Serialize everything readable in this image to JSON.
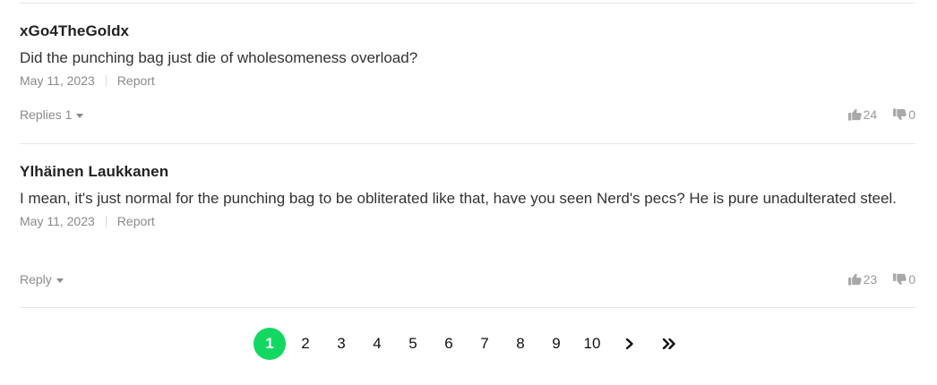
{
  "comments": [
    {
      "username": "xGo4TheGoldx",
      "text": "Did the punching bag just die of wholesomeness overload?",
      "date": "May 11, 2023",
      "report_label": "Report",
      "replies_label": "Replies 1",
      "likes": "24",
      "dislikes": "0"
    },
    {
      "username": "Ylhäinen Laukkanen",
      "text": "I mean, it's just normal for the punching bag to be obliterated like that, have you seen Nerd's pecs? He is pure unadulterated steel.",
      "date": "May 11, 2023",
      "report_label": "Report",
      "replies_label": "Reply",
      "likes": "23",
      "dislikes": "0"
    }
  ],
  "pagination": {
    "pages": [
      "1",
      "2",
      "3",
      "4",
      "5",
      "6",
      "7",
      "8",
      "9",
      "10"
    ],
    "active_page": "1",
    "next_icon": "chevron-right-icon",
    "last_icon": "double-chevron-right-icon"
  },
  "colors": {
    "active_page": "#12d862",
    "meta_text": "#8a8a8a",
    "divider": "#e6e6e6"
  }
}
